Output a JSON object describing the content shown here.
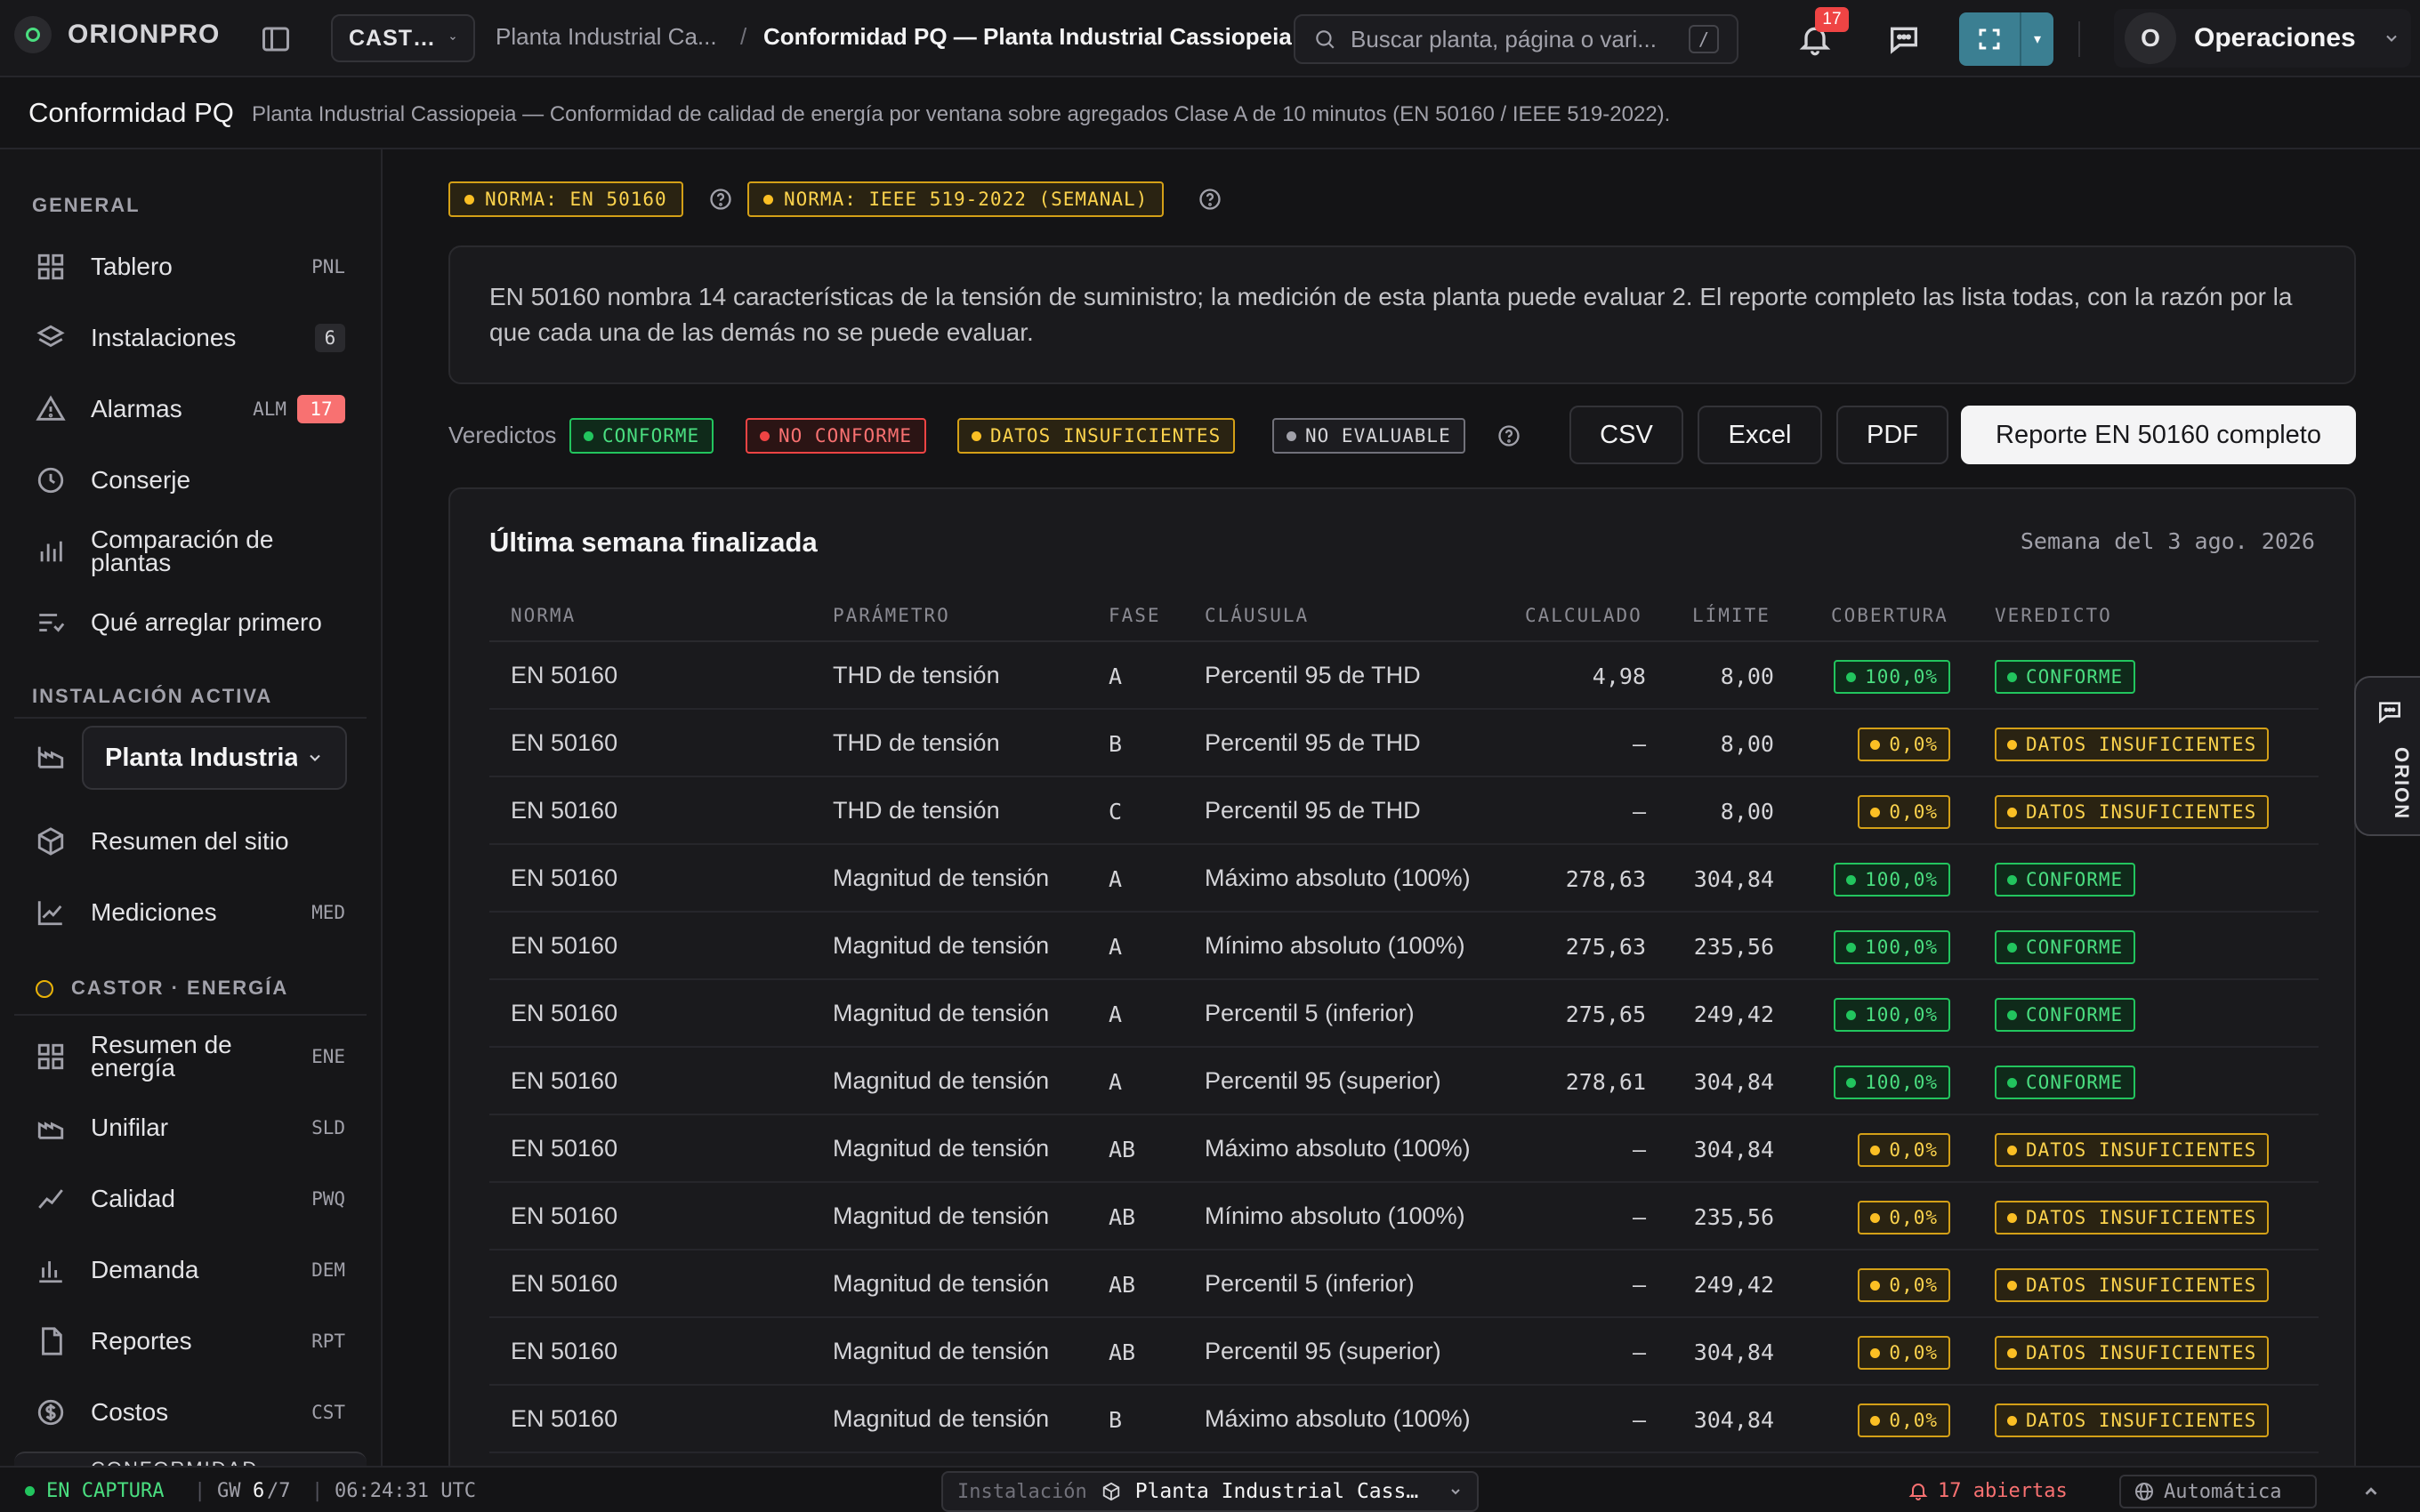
{
  "app": {
    "logo_text": "ORIONPRO"
  },
  "topbar": {
    "plant_short": "CAST…",
    "breadcrumb_parent": "Planta Industrial Ca...",
    "breadcrumb_sep": "/",
    "breadcrumb_current": "Conformidad PQ — Planta Industrial Cassiopeia",
    "search_placeholder": "Buscar planta, página o vari...",
    "search_shortcut": "/",
    "notifications_count": "17",
    "user_initial": "O",
    "user_name": "Operaciones"
  },
  "page": {
    "title": "Conformidad PQ",
    "subtitle": "Planta Industrial Cassiopeia — Conformidad de calidad de energía por ventana sobre agregados Clase A de 10 minutos (EN 50160 / IEEE 519-2022)."
  },
  "sidebar": {
    "general_heading": "GENERAL",
    "general_items": [
      {
        "label": "Tablero",
        "key": "PNL",
        "icon": "grid-icon"
      },
      {
        "label": "Instalaciones",
        "count": "6",
        "icon": "layers-icon"
      },
      {
        "label": "Alarmas",
        "key": "ALM",
        "count": "17",
        "icon": "warning-icon"
      },
      {
        "label": "Conserje",
        "icon": "clock-icon"
      },
      {
        "label": "Comparación de plantas",
        "icon": "bar-chart-icon"
      },
      {
        "label": "Qué arreglar primero",
        "icon": "sort-list-icon"
      }
    ],
    "active_heading": "INSTALACIÓN ACTIVA",
    "active_install": "Planta Industrial Cassiopeia",
    "active_items": [
      {
        "label": "Resumen del sitio",
        "icon": "cube-icon"
      },
      {
        "label": "Mediciones",
        "key": "MED",
        "icon": "line-chart-icon"
      }
    ],
    "castor_heading": "CASTOR · ENERGÍA",
    "castor_items": [
      {
        "label": "Resumen de energía",
        "key": "ENE",
        "icon": "grid-icon"
      },
      {
        "label": "Unifilar",
        "key": "SLD",
        "icon": "factory-icon"
      },
      {
        "label": "Calidad",
        "key": "PWQ",
        "icon": "trend-icon"
      },
      {
        "label": "Demanda",
        "key": "DEM",
        "icon": "bar-chart-icon"
      },
      {
        "label": "Reportes",
        "key": "RPT",
        "icon": "file-icon"
      },
      {
        "label": "Costos",
        "key": "CST",
        "icon": "coin-icon"
      }
    ],
    "bottom_cut_label": "CONFORMIDAD"
  },
  "main": {
    "norm_badges": [
      "NORMA: EN 50160",
      "NORMA: IEEE 519-2022 (SEMANAL)"
    ],
    "notice": "EN 50160 nombra 14 características de la tensión de suministro; la medición de esta planta puede evaluar 2. El reporte completo las lista todas, con la razón por la que cada una de las demás no se puede evaluar.",
    "verdicts_label": "Veredictos",
    "verdicts": {
      "ok": "CONFORME",
      "bad": "NO CONFORME",
      "ins": "DATOS INSUFICIENTES",
      "na": "NO EVALUABLE"
    },
    "buttons": {
      "csv": "CSV",
      "excel": "Excel",
      "pdf": "PDF",
      "report": "Reporte EN 50160 completo"
    },
    "card_title": "Última semana finalizada",
    "card_week": "Semana del 3 ago. 2026",
    "columns": {
      "norma": "NORMA",
      "parametro": "PARÁMETRO",
      "fase": "FASE",
      "clausula": "CLÁUSULA",
      "calculado": "CALCULADO",
      "limite": "LÍMITE",
      "cobertura": "COBERTURA",
      "veredicto": "VEREDICTO"
    },
    "rows": [
      {
        "norma": "EN 50160",
        "parametro": "THD de tensión",
        "fase": "A",
        "clausula": "Percentil 95 de THD",
        "calculado": "4,98",
        "limite": "8,00",
        "cobertura": "100,0%",
        "veredicto": "CONFORME",
        "status": "ok"
      },
      {
        "norma": "EN 50160",
        "parametro": "THD de tensión",
        "fase": "B",
        "clausula": "Percentil 95 de THD",
        "calculado": "—",
        "limite": "8,00",
        "cobertura": "0,0%",
        "veredicto": "DATOS INSUFICIENTES",
        "status": "ins"
      },
      {
        "norma": "EN 50160",
        "parametro": "THD de tensión",
        "fase": "C",
        "clausula": "Percentil 95 de THD",
        "calculado": "—",
        "limite": "8,00",
        "cobertura": "0,0%",
        "veredicto": "DATOS INSUFICIENTES",
        "status": "ins"
      },
      {
        "norma": "EN 50160",
        "parametro": "Magnitud de tensión",
        "fase": "A",
        "clausula": "Máximo absoluto (100%)",
        "calculado": "278,63",
        "limite": "304,84",
        "cobertura": "100,0%",
        "veredicto": "CONFORME",
        "status": "ok"
      },
      {
        "norma": "EN 50160",
        "parametro": "Magnitud de tensión",
        "fase": "A",
        "clausula": "Mínimo absoluto (100%)",
        "calculado": "275,63",
        "limite": "235,56",
        "cobertura": "100,0%",
        "veredicto": "CONFORME",
        "status": "ok"
      },
      {
        "norma": "EN 50160",
        "parametro": "Magnitud de tensión",
        "fase": "A",
        "clausula": "Percentil 5 (inferior)",
        "calculado": "275,65",
        "limite": "249,42",
        "cobertura": "100,0%",
        "veredicto": "CONFORME",
        "status": "ok"
      },
      {
        "norma": "EN 50160",
        "parametro": "Magnitud de tensión",
        "fase": "A",
        "clausula": "Percentil 95 (superior)",
        "calculado": "278,61",
        "limite": "304,84",
        "cobertura": "100,0%",
        "veredicto": "CONFORME",
        "status": "ok"
      },
      {
        "norma": "EN 50160",
        "parametro": "Magnitud de tensión",
        "fase": "AB",
        "clausula": "Máximo absoluto (100%)",
        "calculado": "—",
        "limite": "304,84",
        "cobertura": "0,0%",
        "veredicto": "DATOS INSUFICIENTES",
        "status": "ins"
      },
      {
        "norma": "EN 50160",
        "parametro": "Magnitud de tensión",
        "fase": "AB",
        "clausula": "Mínimo absoluto (100%)",
        "calculado": "—",
        "limite": "235,56",
        "cobertura": "0,0%",
        "veredicto": "DATOS INSUFICIENTES",
        "status": "ins"
      },
      {
        "norma": "EN 50160",
        "parametro": "Magnitud de tensión",
        "fase": "AB",
        "clausula": "Percentil 5 (inferior)",
        "calculado": "—",
        "limite": "249,42",
        "cobertura": "0,0%",
        "veredicto": "DATOS INSUFICIENTES",
        "status": "ins"
      },
      {
        "norma": "EN 50160",
        "parametro": "Magnitud de tensión",
        "fase": "AB",
        "clausula": "Percentil 95 (superior)",
        "calculado": "—",
        "limite": "304,84",
        "cobertura": "0,0%",
        "veredicto": "DATOS INSUFICIENTES",
        "status": "ins"
      },
      {
        "norma": "EN 50160",
        "parametro": "Magnitud de tensión",
        "fase": "B",
        "clausula": "Máximo absoluto (100%)",
        "calculado": "—",
        "limite": "304,84",
        "cobertura": "0,0%",
        "veredicto": "DATOS INSUFICIENTES",
        "status": "ins"
      }
    ],
    "side_tab_label": "ORION"
  },
  "statusbar": {
    "capture": "EN CAPTURA",
    "gw_label": "GW",
    "gw_value": "6",
    "gw_total": "/7",
    "time": "06:24:31 UTC",
    "install_label": "Instalación",
    "install_value": "Planta Industrial Cass…",
    "open_alarms": "17 abiertas",
    "mode": "Automática"
  },
  "colors": {
    "ok": "#4ade80",
    "bad": "#f87171",
    "ins": "#fcd34d",
    "na": "#a1a1aa",
    "accent": "#3b7f92"
  }
}
